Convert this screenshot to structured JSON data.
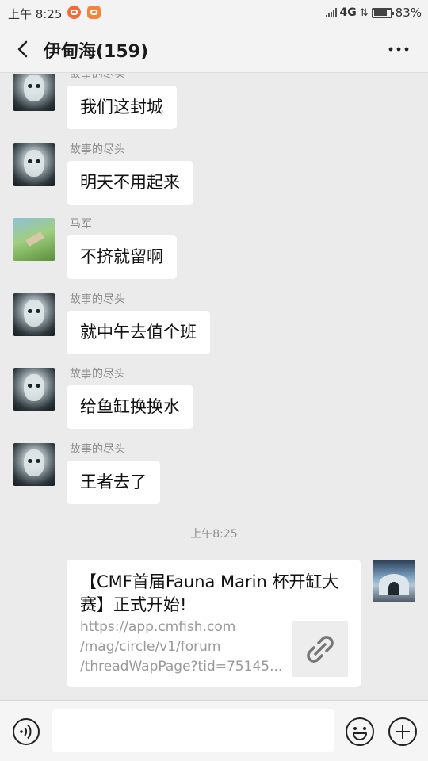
{
  "status_bar": {
    "time": "上午 8:25",
    "network": "4G",
    "battery": "83%",
    "battery_level": 0.83
  },
  "header": {
    "title": "伊甸海(159)",
    "back_icon": "chevron-left-icon",
    "more_icon": "more-dots-icon"
  },
  "messages": [
    {
      "sender": "故事的尽头",
      "text": "我们这封城",
      "avatar": "ghost-avatar"
    },
    {
      "sender": "故事的尽头",
      "text": "明天不用起来",
      "avatar": "ghost-avatar"
    },
    {
      "sender": "马军",
      "text": "不挤就留啊",
      "avatar": "field-avatar"
    },
    {
      "sender": "故事的尽头",
      "text": "就中午去值个班",
      "avatar": "ghost-avatar"
    },
    {
      "sender": "故事的尽头",
      "text": "给鱼缸换换水",
      "avatar": "ghost-avatar"
    },
    {
      "sender": "故事的尽头",
      "text": "王者去了",
      "avatar": "ghost-avatar"
    }
  ],
  "timestamp": "上午8:25",
  "link_card": {
    "title": "【CMF首届Fauna Marin 杯开缸大赛】正式开始!",
    "url_lines": [
      "https://app.cmfish.com",
      "/mag/circle/v1/forum",
      "/threadWapPage?tid=75145..."
    ],
    "thumb_icon": "link-icon"
  },
  "input_bar": {
    "voice_icon": "voice-icon",
    "placeholder": "",
    "emoji_icon": "emoji-icon",
    "plus_icon": "plus-icon"
  }
}
